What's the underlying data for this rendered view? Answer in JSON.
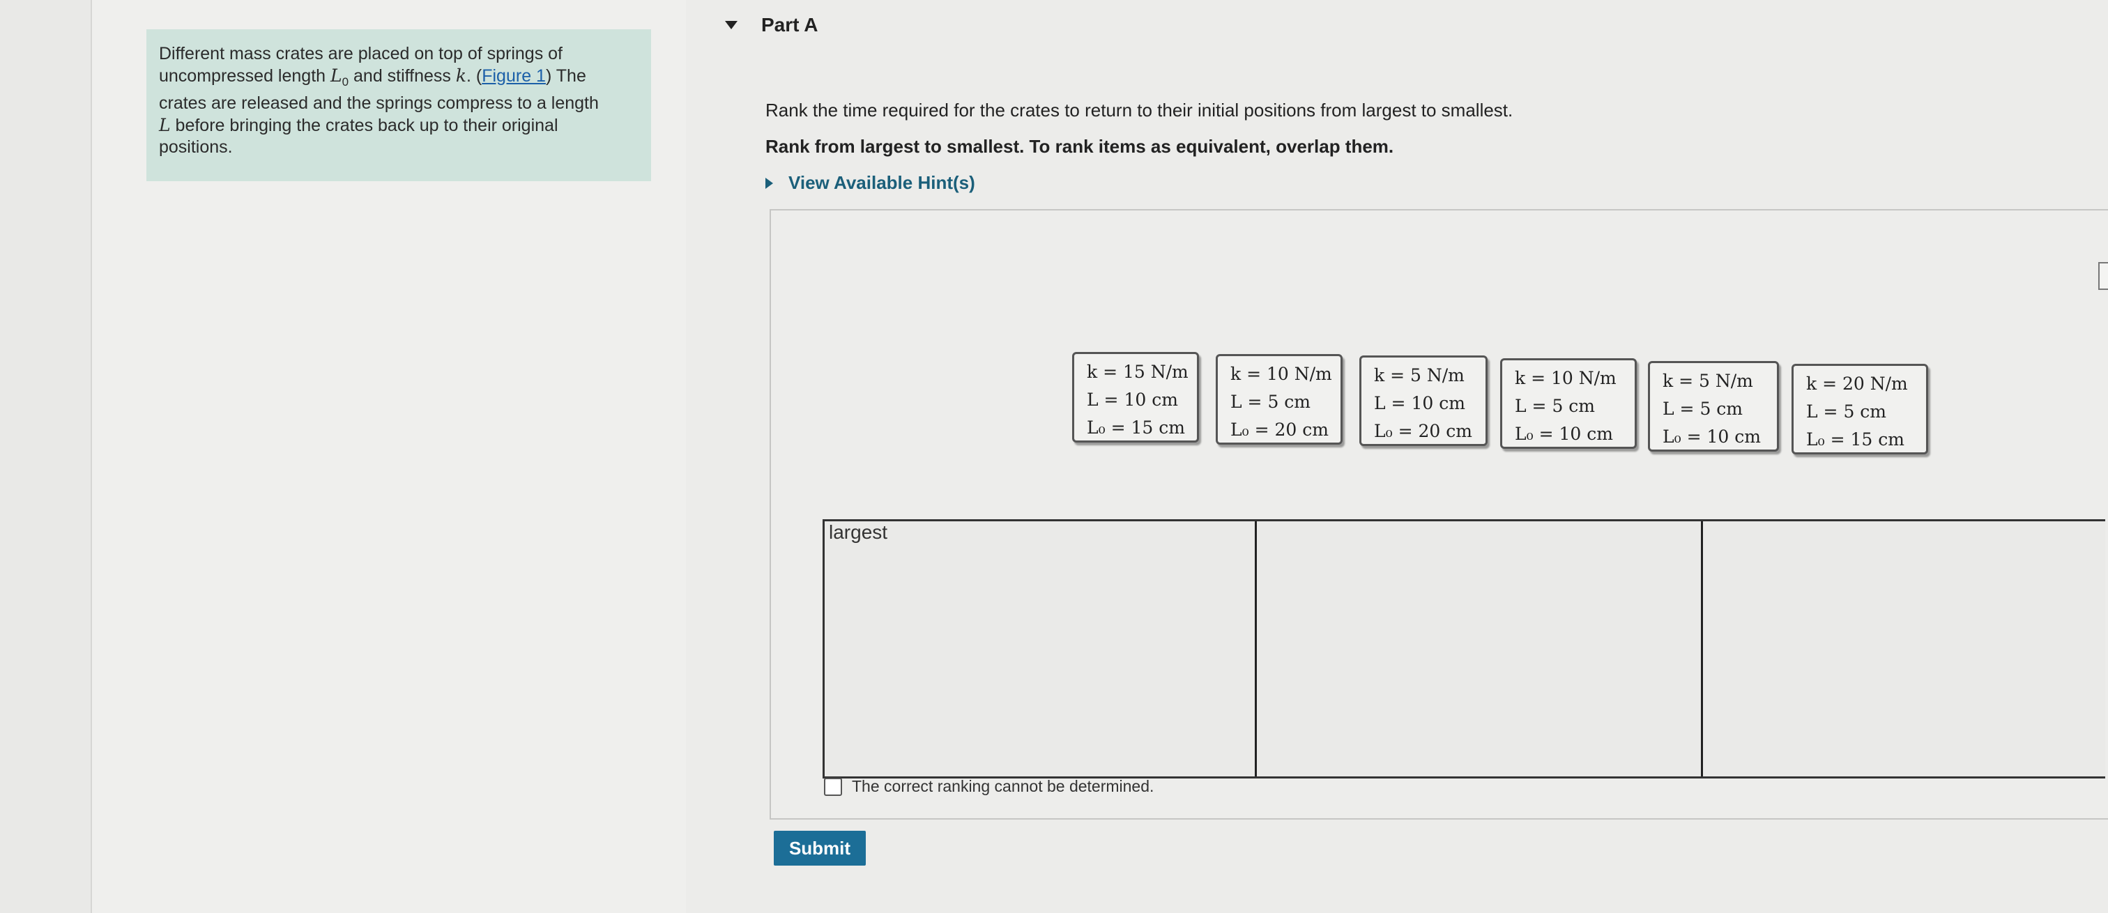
{
  "intro": {
    "line1": "Different mass crates are placed on top of springs of",
    "line2_pre": "uncompressed length ",
    "line2_math": "L",
    "line2_sub": "0",
    "line2_mid": " and stiffness ",
    "line2_k": "k",
    "line2_dot": ". (",
    "figure_link": "Figure 1",
    "line2_post": ") The",
    "line3": "crates are released and the springs compress to a length",
    "line4_math": "L",
    "line4": " before bringing the crates back up to their original",
    "line5": "positions."
  },
  "part": {
    "title": "Part A"
  },
  "question": "Rank the time required for the crates to return to their initial positions from largest to smallest.",
  "instruction": "Rank from largest to smallest. To rank items as equivalent, overlap them.",
  "hint_label": "View Available Hint(s)",
  "tiles": [
    {
      "k": "k = 15 N/m",
      "L": "L = 10 cm",
      "L0": "L₀ = 15 cm"
    },
    {
      "k": "k = 10 N/m",
      "L": "L = 5 cm",
      "L0": "L₀ = 20 cm"
    },
    {
      "k": "k = 5 N/m",
      "L": "L = 10 cm",
      "L0": "L₀ = 20 cm"
    },
    {
      "k": "k = 10 N/m",
      "L": "L = 5 cm",
      "L0": "L₀ = 10 cm"
    },
    {
      "k": "k = 5 N/m",
      "L": "L = 5 cm",
      "L0": "L₀ = 10 cm"
    },
    {
      "k": "k = 20 N/m",
      "L": "L = 5 cm",
      "L0": "L₀ = 15 cm"
    }
  ],
  "bins": {
    "largest_label": "largest"
  },
  "cannot_label": "The correct ranking cannot be determined.",
  "submit_label": "Submit",
  "colors": {
    "intro_bg": "#cfe3dc",
    "submit_bg": "#1c6e97",
    "hint_color": "#1b5f7a",
    "link_color": "#1b5fa8"
  }
}
